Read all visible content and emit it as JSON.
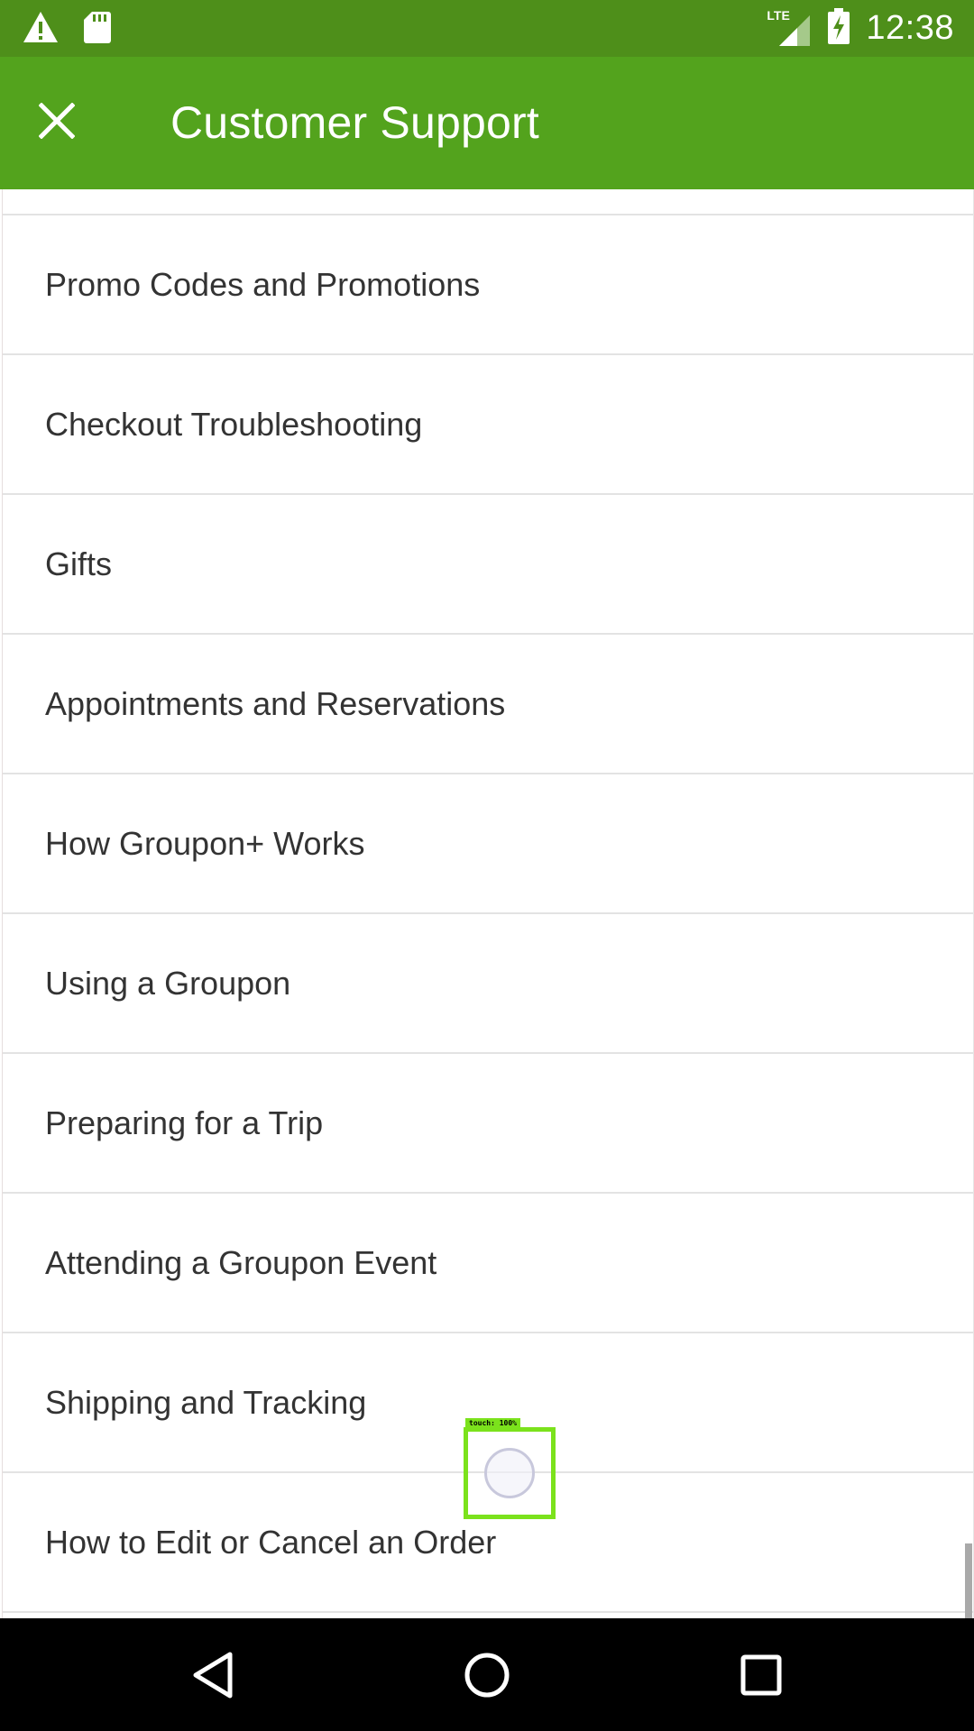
{
  "status_bar": {
    "time": "12:38",
    "network_label": "LTE",
    "icons": [
      "warning-icon",
      "sd-card-icon",
      "lte-signal-icon",
      "battery-charging-icon"
    ]
  },
  "app_bar": {
    "title": "Customer Support",
    "close_icon": "close-icon"
  },
  "list": {
    "items": [
      {
        "label": "Promo Codes and Promotions"
      },
      {
        "label": "Checkout Troubleshooting"
      },
      {
        "label": "Gifts"
      },
      {
        "label": "Appointments and Reservations"
      },
      {
        "label": "How Groupon+ Works"
      },
      {
        "label": "Using a Groupon"
      },
      {
        "label": "Preparing for a Trip"
      },
      {
        "label": "Attending a Groupon Event"
      },
      {
        "label": "Shipping and Tracking"
      },
      {
        "label": "How to Edit or Cancel an Order"
      }
    ]
  },
  "touch_indicator": {
    "label": "touch: 100%"
  },
  "nav_bar": {
    "icons": [
      "back-icon",
      "home-icon",
      "recents-icon"
    ]
  },
  "colors": {
    "status_bar": "#4e8f1a",
    "app_bar": "#53a31d",
    "text": "#333333",
    "divider": "#e3e3e3",
    "touch_highlight": "#7be21c"
  }
}
